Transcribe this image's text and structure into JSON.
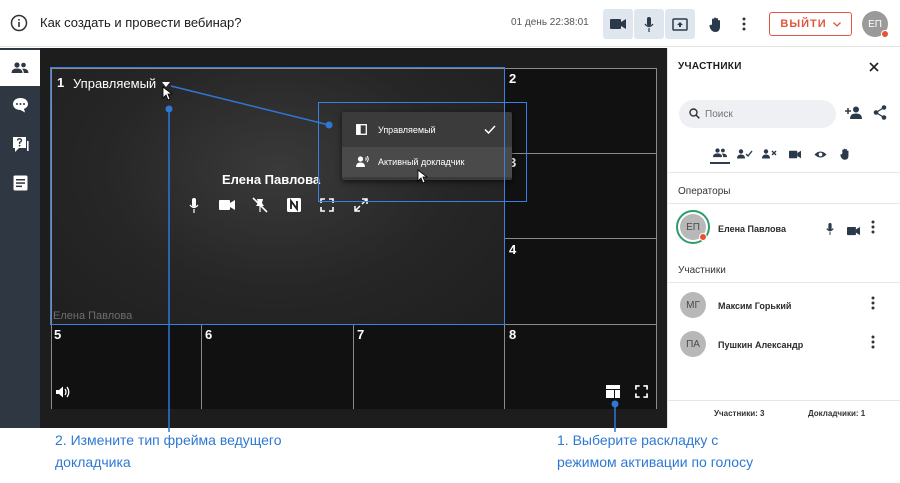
{
  "header": {
    "title": "Как создать и провести вебинар?",
    "timer": "01 день 22:38:01",
    "exit_label": "ВЫЙТИ",
    "user_initials": "ЕП"
  },
  "stage": {
    "tile_numbers": [
      "1",
      "2",
      "3",
      "4",
      "5",
      "6",
      "7",
      "8"
    ],
    "mode_label": "Управляемый",
    "presenter_name": "Елена Павлова",
    "ghost_name": "Елена Павлова"
  },
  "dropdown": {
    "items": [
      {
        "label": "Управляемый",
        "checked": true
      },
      {
        "label": "Активный докладчик",
        "checked": false
      }
    ]
  },
  "panel": {
    "title": "УЧАСТНИКИ",
    "search_placeholder": "Поиск",
    "operators_label": "Операторы",
    "participants_label": "Участники",
    "operators": [
      {
        "initials": "ЕП",
        "name": "Елена Павлова"
      }
    ],
    "participants": [
      {
        "initials": "МГ",
        "name": "Максим Горький"
      },
      {
        "initials": "ПА",
        "name": "Пушкин Александр"
      }
    ],
    "participants_count": "Участники: 3",
    "speakers_count": "Докладчики: 1"
  },
  "annotations": {
    "left_line1": "2. Измените тип фрейма ведущего",
    "left_line2": "докладчика",
    "right_line1": "1. Выберите раскладку с",
    "right_line2": "режимом активации по голосу"
  },
  "colors": {
    "accent": "#2e78d4",
    "exit": "#e0573e",
    "rail": "#2f3742"
  }
}
